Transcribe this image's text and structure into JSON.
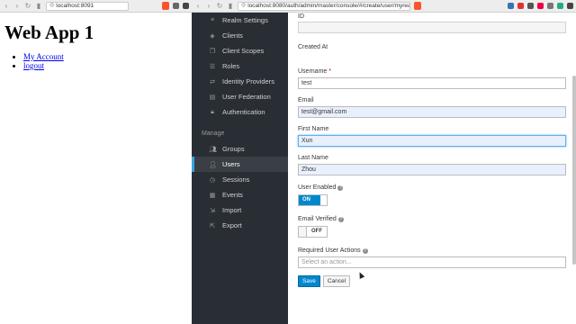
{
  "left_browser": {
    "url": "localhost:8091",
    "heading": "Web App 1",
    "links": [
      "My Account",
      "logout"
    ]
  },
  "right_browser": {
    "url": "localhost:8080/auth/admin/master/console/#/create/user/myrealm"
  },
  "sidebar": {
    "configure_items": [
      {
        "label": "Realm Settings",
        "icon": "sliders-icon"
      },
      {
        "label": "Clients",
        "icon": "cube-icon"
      },
      {
        "label": "Client Scopes",
        "icon": "clone-icon"
      },
      {
        "label": "Roles",
        "icon": "list-icon"
      },
      {
        "label": "Identity Providers",
        "icon": "exchange-icon"
      },
      {
        "label": "User Federation",
        "icon": "database-icon"
      },
      {
        "label": "Authentication",
        "icon": "lock-icon"
      }
    ],
    "manage_heading": "Manage",
    "manage_items": [
      {
        "label": "Groups",
        "icon": "users-icon"
      },
      {
        "label": "Users",
        "icon": "user-icon",
        "active": true
      },
      {
        "label": "Sessions",
        "icon": "clock-icon"
      },
      {
        "label": "Events",
        "icon": "calendar-icon"
      },
      {
        "label": "Import",
        "icon": "import-icon"
      },
      {
        "label": "Export",
        "icon": "export-icon"
      }
    ]
  },
  "form": {
    "id_label": "ID",
    "created_at_label": "Created At",
    "username_label": "Username",
    "username_required": "*",
    "username_value": "test",
    "email_label": "Email",
    "email_value": "test@gmail.com",
    "first_name_label": "First Name",
    "first_name_value": "Xun",
    "last_name_label": "Last Name",
    "last_name_value": "Zhou",
    "user_enabled_label": "User Enabled",
    "user_enabled_state": "ON",
    "email_verified_label": "Email Verified",
    "email_verified_state": "OFF",
    "required_actions_label": "Required User Actions",
    "required_actions_placeholder": "Select an action...",
    "save_label": "Save",
    "cancel_label": "Cancel"
  },
  "colors": {
    "sidebar_bg": "#292e34",
    "accent": "#0088ce",
    "active_bar": "#39a5dc"
  }
}
